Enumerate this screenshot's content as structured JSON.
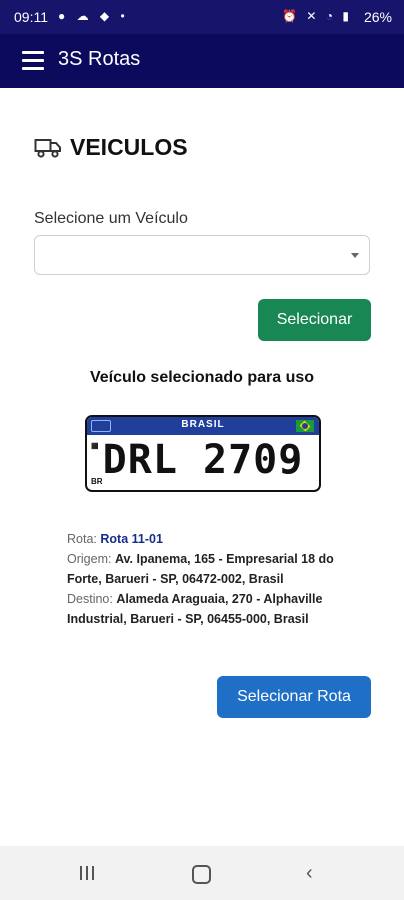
{
  "status_bar": {
    "time": "09:11",
    "left_icons": "● ☁ ◆ •",
    "right_icons": "⏰ ✕ ◔ ▮",
    "battery": "26%"
  },
  "app_bar": {
    "title": "3S Rotas",
    "menu_icon": "hamburger-menu"
  },
  "page": {
    "title": "VEICULOS",
    "icon": "truck"
  },
  "vehicle_select": {
    "label": "Selecione um Veículo",
    "value": ""
  },
  "buttons": {
    "select": "Selecionar",
    "select_route": "Selecionar Rota"
  },
  "selected_vehicle": {
    "heading": "Veículo selecionado para uso",
    "plate_country": "BRASIL",
    "plate_number": "DRL 2709",
    "plate_left_mark": "BR"
  },
  "route": {
    "rota_label": "Rota:",
    "rota_value": "Rota 11-01",
    "origem_label": "Origem:",
    "origem_value": "Av. Ipanema, 165 - Empresarial 18 do Forte, Barueri - SP, 06472-002, Brasil",
    "destino_label": "Destino:",
    "destino_value": "Alameda Araguaia, 270 - Alphaville Industrial, Barueri - SP, 06455-000, Brasil"
  },
  "colors": {
    "status_bar": "#17146b",
    "app_bar": "#0b0a5c",
    "select_button": "#198754",
    "route_button": "#1f6fc6",
    "plate_header": "#1f3f9a"
  }
}
